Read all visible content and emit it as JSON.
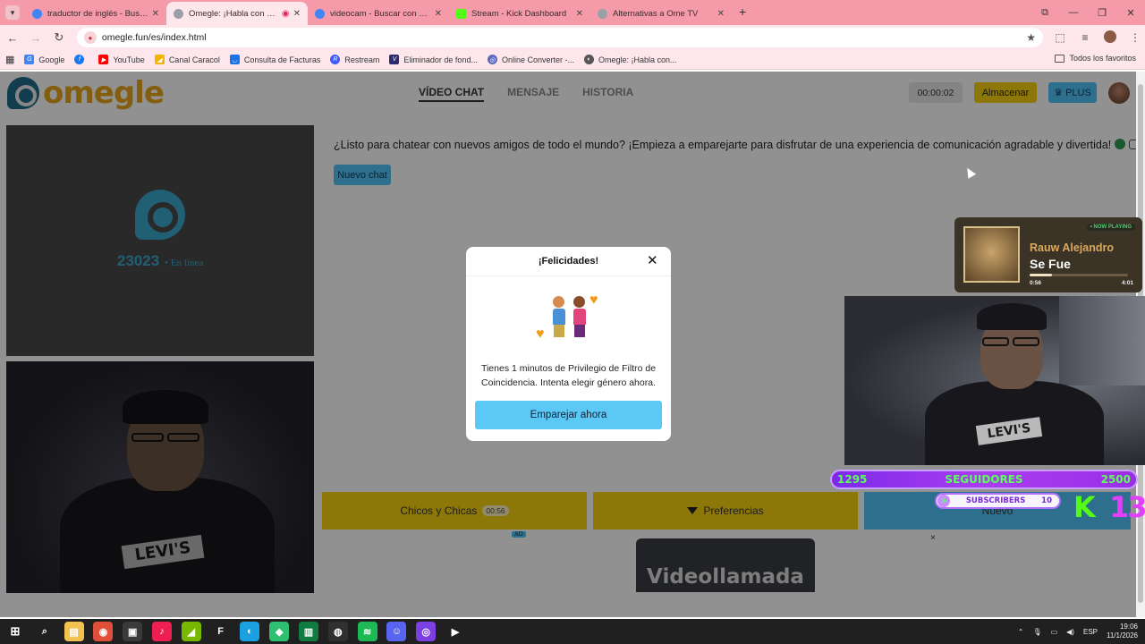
{
  "browser": {
    "tabs": [
      {
        "title": "traductor de inglés - Buscar con",
        "favicon_color": "#4285F4",
        "active": false
      },
      {
        "title": "Omegle: ¡Habla con Descor",
        "favicon_color": "#9aa0a6",
        "active": true
      },
      {
        "title": "videocam - Buscar con Google",
        "favicon_color": "#4285F4",
        "active": false
      },
      {
        "title": "Stream - Kick Dashboard",
        "favicon_color": "#53FC18",
        "active": false
      },
      {
        "title": "Alternativas a Ome TV",
        "favicon_color": "#9aa0a6",
        "active": false
      }
    ],
    "new_tab": "+",
    "url": "omegle.fun/es/index.html",
    "bookmarks": [
      {
        "label": "Google",
        "icon": "google-icon",
        "color": "#4285F4"
      },
      {
        "label": "YouTube",
        "icon": "youtube-icon",
        "color": "#FF0000"
      },
      {
        "label": "Canal Caracol",
        "icon": "caracol-icon",
        "color": "#f5b400"
      },
      {
        "label": "Consulta de Facturas",
        "icon": "invoice-icon",
        "color": "#1a73e8"
      },
      {
        "label": "Restream",
        "icon": "restream-icon",
        "color": "#3d5afe"
      },
      {
        "label": "Eliminador de fond...",
        "icon": "remover-icon",
        "color": "#2b2b6e"
      },
      {
        "label": "Online Converter -...",
        "icon": "converter-icon",
        "color": "#5c6bc0"
      },
      {
        "label": "Omegle: ¡Habla con...",
        "icon": "omegle-icon",
        "color": "#555555"
      }
    ],
    "all_bookmarks": "Todos los favoritos"
  },
  "site": {
    "logo_text": "omegle",
    "nav": [
      {
        "label": "VÍDEO CHAT",
        "active": true
      },
      {
        "label": "MENSAJE",
        "active": false
      },
      {
        "label": "HISTORIA",
        "active": false
      }
    ],
    "timer": "00:00:02",
    "store_label": "Almacenar",
    "plus_label": "PLUS",
    "online_count": "23023",
    "online_label": "• En línea",
    "welcome": "¿Listo para chatear con nuevos amigos de todo el mundo? ¡Empieza a emparejarte para disfrutar de una experiencia de comunicación agradable y divertida!",
    "new_chat": "Nuevo chat",
    "gender_button": "Chicos y Chicas",
    "gender_time": "00:56",
    "preferences_button": "Preferencias",
    "next_button": "Nuevo",
    "ad_tag": "AD",
    "ad_close": "×",
    "ad_text": "Videollamada",
    "self_shirt": "LEVI'S"
  },
  "modal": {
    "title": "¡Felicidades!",
    "close": "✕",
    "body": "Tienes 1 minutos de Privilegio de Filtro de Coincidencia. Intenta elegir género ahora.",
    "cta": "Emparejar ahora"
  },
  "overlay": {
    "now_playing_tag": "• NOW PLAYING",
    "artist": "Rauw Alejandro",
    "song": "Se Fue",
    "elapsed": "0:56",
    "duration": "4:01",
    "progress": 0.23,
    "followers_current": "1295",
    "followers_label": "SEGUIDORES",
    "followers_goal": "2500",
    "subs_current": "0",
    "subs_label": "SUBSCRIBERS",
    "subs_goal": "10",
    "kick_letter": "K",
    "kick_number": "13",
    "cam_shirt": "LEVI'S"
  },
  "taskbar": {
    "apps": [
      {
        "name": "search-icon",
        "glyph": "⌕",
        "color": "#202020"
      },
      {
        "name": "file-explorer-icon",
        "glyph": "▤",
        "color": "#f2c14e"
      },
      {
        "name": "chrome-icon",
        "glyph": "◉",
        "color": "#e04f3a"
      },
      {
        "name": "call-of-duty-icon",
        "glyph": "▣",
        "color": "#3a3a3a"
      },
      {
        "name": "tiktok-icon",
        "glyph": "♪",
        "color": "#ee1d52"
      },
      {
        "name": "nvidia-icon",
        "glyph": "◢",
        "color": "#76b900"
      },
      {
        "name": "tf-icon",
        "glyph": "F",
        "color": "#202020"
      },
      {
        "name": "edge-icon",
        "glyph": "◐",
        "color": "#1ba1e2"
      },
      {
        "name": "game-icon",
        "glyph": "◆",
        "color": "#2fbf71"
      },
      {
        "name": "terminal-icon",
        "glyph": "▥",
        "color": "#107c41"
      },
      {
        "name": "obs-icon",
        "glyph": "◍",
        "color": "#303030"
      },
      {
        "name": "spotify-icon",
        "glyph": "≋",
        "color": "#1db954"
      },
      {
        "name": "discord-icon",
        "glyph": "☺",
        "color": "#5865f2"
      },
      {
        "name": "streamlabs-icon",
        "glyph": "◎",
        "color": "#7b3fe4"
      },
      {
        "name": "kick-icon",
        "glyph": "▶",
        "color": "#202020"
      }
    ],
    "lang": "ESP",
    "time": "19:06",
    "date": "11/1/2026"
  }
}
